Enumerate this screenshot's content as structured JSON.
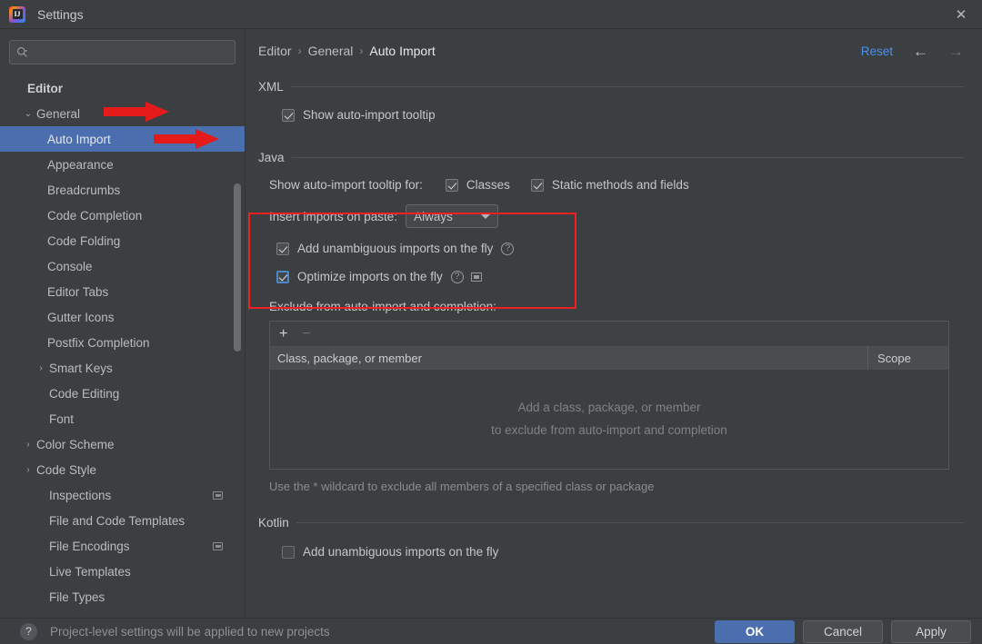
{
  "window": {
    "title": "Settings",
    "app_icon": "intellij-idea-icon",
    "close_label": "✕"
  },
  "sidebar": {
    "search": {
      "placeholder": "",
      "value": "",
      "icon": "search-icon"
    },
    "items": [
      {
        "label": "Editor",
        "level": 0,
        "arrow": "",
        "selected": false,
        "badge": false
      },
      {
        "label": "General",
        "level": 1,
        "arrow": "⌄",
        "selected": false,
        "badge": false
      },
      {
        "label": "Auto Import",
        "level": 2,
        "arrow": "",
        "selected": true,
        "badge": false
      },
      {
        "label": "Appearance",
        "level": 2,
        "arrow": "",
        "selected": false,
        "badge": false
      },
      {
        "label": "Breadcrumbs",
        "level": 2,
        "arrow": "",
        "selected": false,
        "badge": false
      },
      {
        "label": "Code Completion",
        "level": 2,
        "arrow": "",
        "selected": false,
        "badge": false
      },
      {
        "label": "Code Folding",
        "level": 2,
        "arrow": "",
        "selected": false,
        "badge": false
      },
      {
        "label": "Console",
        "level": 2,
        "arrow": "",
        "selected": false,
        "badge": false
      },
      {
        "label": "Editor Tabs",
        "level": 2,
        "arrow": "",
        "selected": false,
        "badge": false
      },
      {
        "label": "Gutter Icons",
        "level": 2,
        "arrow": "",
        "selected": false,
        "badge": false
      },
      {
        "label": "Postfix Completion",
        "level": 2,
        "arrow": "",
        "selected": false,
        "badge": false
      },
      {
        "label": "Smart Keys",
        "level": 1,
        "arrow": "›",
        "selected": false,
        "badge": false
      },
      {
        "label": "Code Editing",
        "level": 1,
        "arrow": "",
        "selected": false,
        "badge": false
      },
      {
        "label": "Font",
        "level": 1,
        "arrow": "",
        "selected": false,
        "badge": false
      },
      {
        "label": "Color Scheme",
        "level": 1,
        "arrow": "›",
        "selected": false,
        "badge": false
      },
      {
        "label": "Code Style",
        "level": 1,
        "arrow": "›",
        "selected": false,
        "badge": false
      },
      {
        "label": "Inspections",
        "level": 1,
        "arrow": "",
        "selected": false,
        "badge": true
      },
      {
        "label": "File and Code Templates",
        "level": 1,
        "arrow": "",
        "selected": false,
        "badge": false
      },
      {
        "label": "File Encodings",
        "level": 1,
        "arrow": "",
        "selected": false,
        "badge": true
      },
      {
        "label": "Live Templates",
        "level": 1,
        "arrow": "",
        "selected": false,
        "badge": false
      },
      {
        "label": "File Types",
        "level": 1,
        "arrow": "",
        "selected": false,
        "badge": false
      }
    ]
  },
  "main": {
    "breadcrumb": {
      "part1": "Editor",
      "part2": "General",
      "part3": "Auto Import",
      "separator": "›"
    },
    "reset_label": "Reset",
    "back_arrow": "←",
    "forward_arrow": "→",
    "sections": {
      "xml": {
        "title": "XML",
        "show_tooltip": {
          "label": "Show auto-import tooltip",
          "checked": true
        }
      },
      "java": {
        "title": "Java",
        "tooltip_for_label": "Show auto-import tooltip for:",
        "classes": {
          "label": "Classes",
          "checked": true
        },
        "static": {
          "label": "Static methods and fields",
          "checked": true
        },
        "insert_label": "Insert imports on paste:",
        "insert_value": "Always",
        "add_unambiguous": {
          "label": "Add unambiguous imports on the fly",
          "checked": true
        },
        "optimize": {
          "label": "Optimize imports on the fly",
          "checked": true
        },
        "help_glyph": "?",
        "exclude_title": "Exclude from auto-import and completion:",
        "toolbar": {
          "add": "+",
          "remove": "−"
        },
        "columns": {
          "main": "Class, package, or member",
          "scope": "Scope"
        },
        "empty_line1": "Add a class, package, or member",
        "empty_line2": "to exclude from auto-import and completion",
        "hint": "Use the * wildcard to exclude all members of a specified class or package"
      },
      "kotlin": {
        "title": "Kotlin",
        "add_unambiguous": {
          "label": "Add unambiguous imports on the fly",
          "checked": false
        }
      }
    }
  },
  "footer": {
    "help_glyph": "?",
    "note": "Project-level settings will be applied to new projects",
    "ok": "OK",
    "cancel": "Cancel",
    "apply": "Apply"
  },
  "colors": {
    "accent_blue": "#4b6eaf",
    "link_blue": "#4d90e8",
    "annotation_red": "#f21f1f",
    "panel_bg": "#3c3f41"
  }
}
